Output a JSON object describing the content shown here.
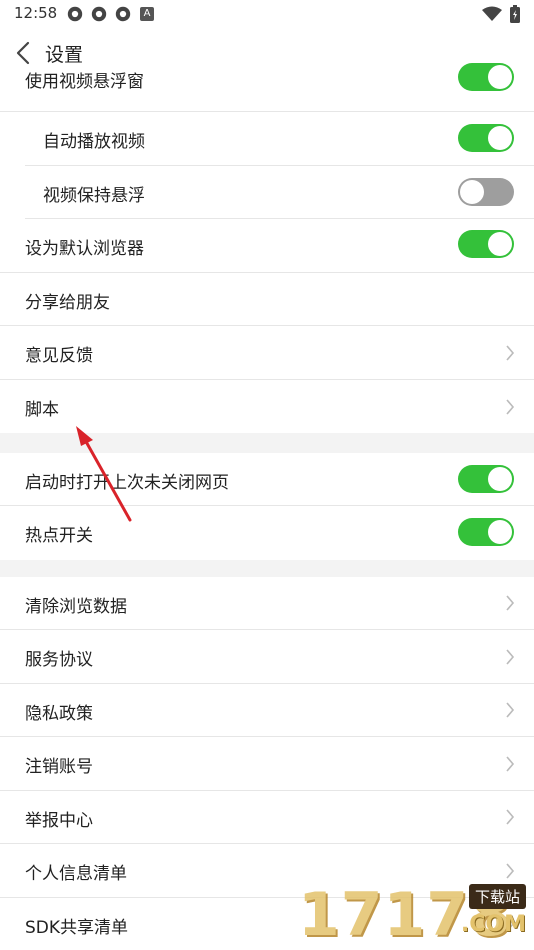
{
  "status_bar": {
    "time": "12:58",
    "app_icons": [
      "gear-icon",
      "gear-icon",
      "gear-icon"
    ],
    "badge": "A",
    "right_icons": [
      "wifi-icon",
      "battery-charging-icon"
    ]
  },
  "header": {
    "title": "设置"
  },
  "rows": [
    {
      "label": "使用视频悬浮窗",
      "control": "toggle",
      "on": true
    },
    {
      "label": "自动播放视频",
      "control": "toggle",
      "on": true
    },
    {
      "label": "视频保持悬浮",
      "control": "toggle",
      "on": false
    },
    {
      "label": "设为默认浏览器",
      "control": "toggle",
      "on": true
    },
    {
      "label": "分享给朋友",
      "control": "none"
    },
    {
      "label": "意见反馈",
      "control": "chevron"
    },
    {
      "label": "脚本",
      "control": "chevron"
    },
    {
      "label": "启动时打开上次未关闭网页",
      "control": "toggle",
      "on": true
    },
    {
      "label": "热点开关",
      "control": "toggle",
      "on": true
    },
    {
      "label": "清除浏览数据",
      "control": "chevron"
    },
    {
      "label": "服务协议",
      "control": "chevron"
    },
    {
      "label": "隐私政策",
      "control": "chevron"
    },
    {
      "label": "注销账号",
      "control": "chevron"
    },
    {
      "label": "举报中心",
      "control": "chevron"
    },
    {
      "label": "个人信息清单",
      "control": "chevron"
    },
    {
      "label": "SDK共享清单",
      "control": "chevron"
    }
  ],
  "colors": {
    "toggle_on": "#34c13a",
    "toggle_off": "#9e9e9e",
    "annotation_arrow": "#d9232a"
  },
  "watermark": {
    "number": "17178",
    "badge": "下载站",
    "domain": ".COM"
  }
}
